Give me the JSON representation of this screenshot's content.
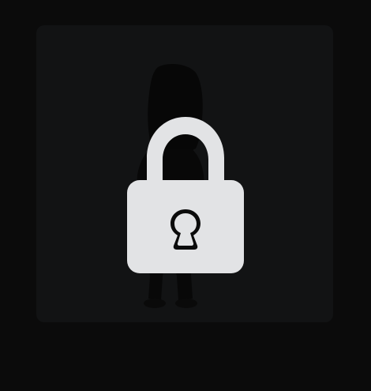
{
  "screen": {
    "background_color": "#0b0b0b",
    "tile_color": "#121314"
  },
  "lock_overlay": {
    "icon": "padlock-icon",
    "icon_color": "#e2e3e5",
    "keyhole_color": "#0b0b0b",
    "state": "locked"
  },
  "background_image": {
    "description_icon": "person-silhouette-icon",
    "tint_color": "#050505"
  }
}
